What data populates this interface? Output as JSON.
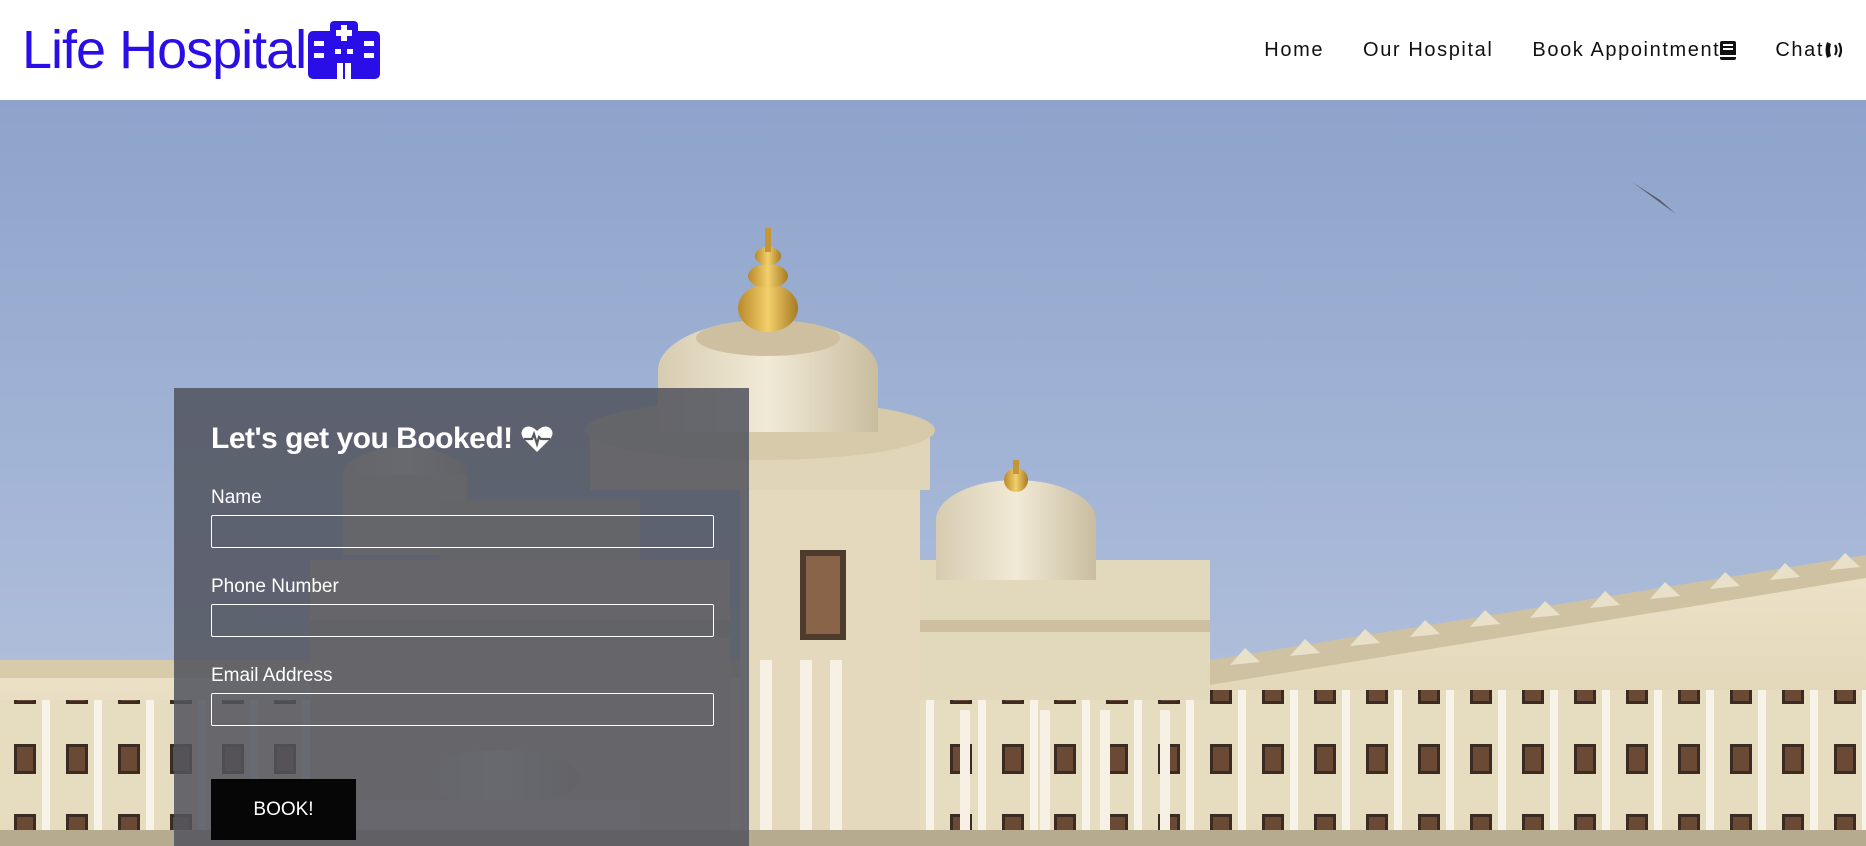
{
  "brand": {
    "name": "Life Hospital",
    "color": "#2a0ee8",
    "icon": "hospital-icon"
  },
  "nav": {
    "items": [
      {
        "label": "Home",
        "icon": ""
      },
      {
        "label": "Our Hospital",
        "icon": ""
      },
      {
        "label": "Book Appointment",
        "icon": "book-icon"
      },
      {
        "label": "Chat",
        "icon": "phone-volume-icon"
      }
    ]
  },
  "booking": {
    "title": "Let's get you Booked!",
    "title_icon": "heartbeat-icon",
    "fields": [
      {
        "label": "Name",
        "value": "",
        "placeholder": ""
      },
      {
        "label": "Phone Number",
        "value": "",
        "placeholder": ""
      },
      {
        "label": "Email Address",
        "value": "",
        "placeholder": ""
      }
    ],
    "submit_label": "BOOK!"
  },
  "hero": {
    "image": "hospital-building-photo",
    "sky_color": "#9fb1d5"
  }
}
